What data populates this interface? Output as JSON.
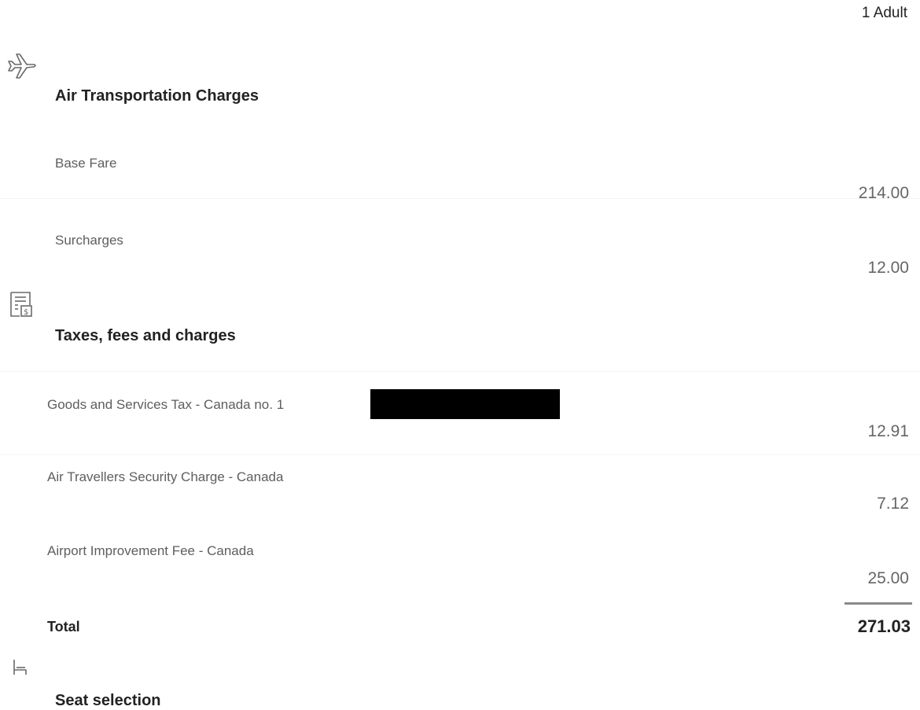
{
  "header": {
    "passenger_label": "1 Adult"
  },
  "sections": {
    "air_transport": {
      "icon": "airplane-icon",
      "title": "Air Transportation Charges",
      "lines": [
        {
          "label": "Base Fare",
          "amount": "214.00"
        },
        {
          "label": "Surcharges",
          "amount": "12.00"
        }
      ]
    },
    "taxes": {
      "icon": "receipt-icon",
      "title": "Taxes, fees and charges",
      "lines": [
        {
          "label": "Goods and Services Tax - Canada no. 1",
          "amount": "12.91",
          "redacted": true
        },
        {
          "label": "Air Travellers Security Charge - Canada",
          "amount": "7.12"
        },
        {
          "label": "Airport Improvement Fee - Canada",
          "amount": "25.00"
        }
      ]
    },
    "total": {
      "label": "Total",
      "amount": "271.03"
    },
    "seat": {
      "icon": "seat-icon",
      "title": "Seat selection"
    }
  }
}
